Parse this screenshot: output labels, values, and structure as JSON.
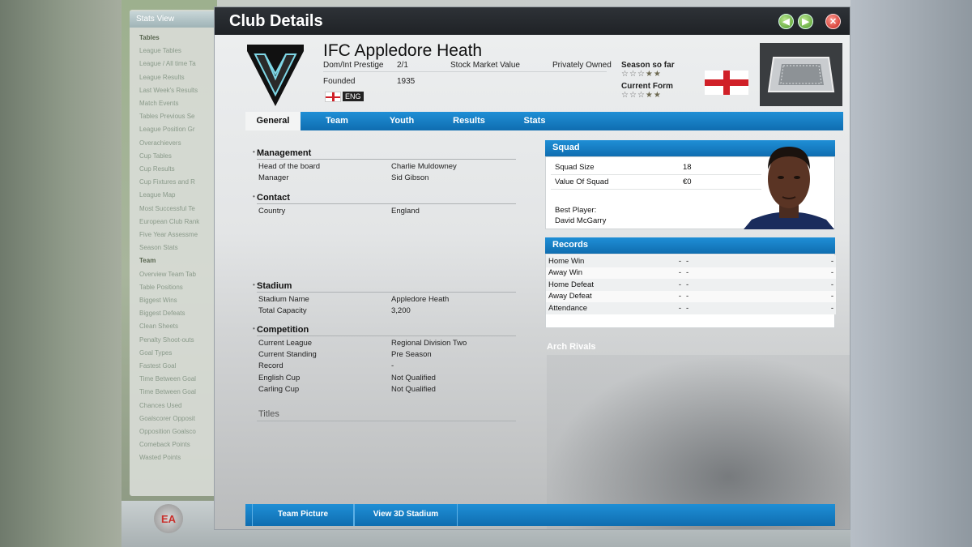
{
  "background": {
    "sidebar_title": "Stats View",
    "sidebar_items": [
      {
        "label": "Tables",
        "header": true
      },
      {
        "label": "League Tables"
      },
      {
        "label": "League / All time Ta"
      },
      {
        "label": "League Results"
      },
      {
        "label": "Last Week's Results"
      },
      {
        "label": "Match Events"
      },
      {
        "label": "Tables Previous Se"
      },
      {
        "label": "League Position Gr"
      },
      {
        "label": "Overachievers"
      },
      {
        "label": "Cup Tables"
      },
      {
        "label": "Cup Results"
      },
      {
        "label": "Cup Fixtures and R"
      },
      {
        "label": "League Map"
      },
      {
        "label": "Most Successful Te"
      },
      {
        "label": "European Club Rank"
      },
      {
        "label": "Five Year Assessme"
      },
      {
        "label": "Season Stats"
      },
      {
        "label": "Team",
        "header": true
      },
      {
        "label": "Overview Team Tab"
      },
      {
        "label": "Table Positions"
      },
      {
        "label": "Biggest Wins"
      },
      {
        "label": "Biggest Defeats"
      },
      {
        "label": "Clean Sheets"
      },
      {
        "label": "Penalty Shoot-outs"
      },
      {
        "label": "Goal Types"
      },
      {
        "label": "Fastest Goal"
      },
      {
        "label": "Time Between Goal"
      },
      {
        "label": "Time Between Goal"
      },
      {
        "label": "Chances Used"
      },
      {
        "label": "Goalscorer Opposit"
      },
      {
        "label": "Opposition Goalsco"
      },
      {
        "label": "Comeback Points"
      },
      {
        "label": "Wasted Points"
      }
    ],
    "logo_text": "EA"
  },
  "window": {
    "title": "Club Details",
    "back_icon": "arrow-left-icon",
    "forward_icon": "arrow-right-icon",
    "close_icon": "close-icon"
  },
  "club": {
    "name": "IFC Appledore Heath",
    "prestige_label": "Dom/Int Prestige",
    "prestige_value": "2/1",
    "founded_label": "Founded",
    "founded_value": "1935",
    "stock_label": "Stock Market Value",
    "stock_value": "Privately Owned",
    "season_label": "Season so far",
    "season_stars": 2,
    "form_label": "Current Form",
    "form_stars": 2,
    "stars_total": 5,
    "nation_code": "ENG"
  },
  "tabs": [
    {
      "label": "General",
      "active": true
    },
    {
      "label": "Team"
    },
    {
      "label": "Youth"
    },
    {
      "label": "Results"
    },
    {
      "label": "Stats"
    }
  ],
  "general": {
    "management": {
      "heading": "Management",
      "rows": [
        {
          "label": "Head of the board",
          "value": "Charlie Muldowney"
        },
        {
          "label": "Manager",
          "value": "Sid Gibson"
        }
      ]
    },
    "contact": {
      "heading": "Contact",
      "rows": [
        {
          "label": "Country",
          "value": "England"
        }
      ]
    },
    "stadium": {
      "heading": "Stadium",
      "rows": [
        {
          "label": "Stadium Name",
          "value": "Appledore Heath"
        },
        {
          "label": "Total Capacity",
          "value": "3,200"
        }
      ]
    },
    "competition": {
      "heading": "Competition",
      "rows": [
        {
          "label": "Current League",
          "value": "Regional Division Two"
        },
        {
          "label": "Current Standing",
          "value": "Pre Season"
        },
        {
          "label": "Record",
          "value": "-"
        },
        {
          "label": "English Cup",
          "value": "Not Qualified"
        },
        {
          "label": "Carling Cup",
          "value": "Not Qualified"
        }
      ]
    },
    "titles_heading": "Titles"
  },
  "squad": {
    "heading": "Squad",
    "size_label": "Squad Size",
    "size_value": "18",
    "value_label": "Value Of Squad",
    "value_value": "€0",
    "best_label": "Best Player:",
    "best_value": "David McGarry"
  },
  "records": {
    "heading": "Records",
    "rows": [
      {
        "label": "Home Win",
        "c1": "-",
        "c2": "-",
        "c3": "-"
      },
      {
        "label": "Away Win",
        "c1": "-",
        "c2": "-",
        "c3": "-"
      },
      {
        "label": "Home Defeat",
        "c1": "-",
        "c2": "-",
        "c3": "-"
      },
      {
        "label": "Away Defeat",
        "c1": "-",
        "c2": "-",
        "c3": "-"
      },
      {
        "label": "Attendance",
        "c1": "-",
        "c2": "-",
        "c3": "-"
      }
    ]
  },
  "arch_rivals_heading": "Arch Rivals",
  "bottom_buttons": [
    {
      "label": "Team Picture"
    },
    {
      "label": "View 3D Stadium"
    }
  ],
  "colors": {
    "accent_blue": "#1479c2",
    "close_red": "#c7231a",
    "nav_green": "#4f9a2a"
  }
}
